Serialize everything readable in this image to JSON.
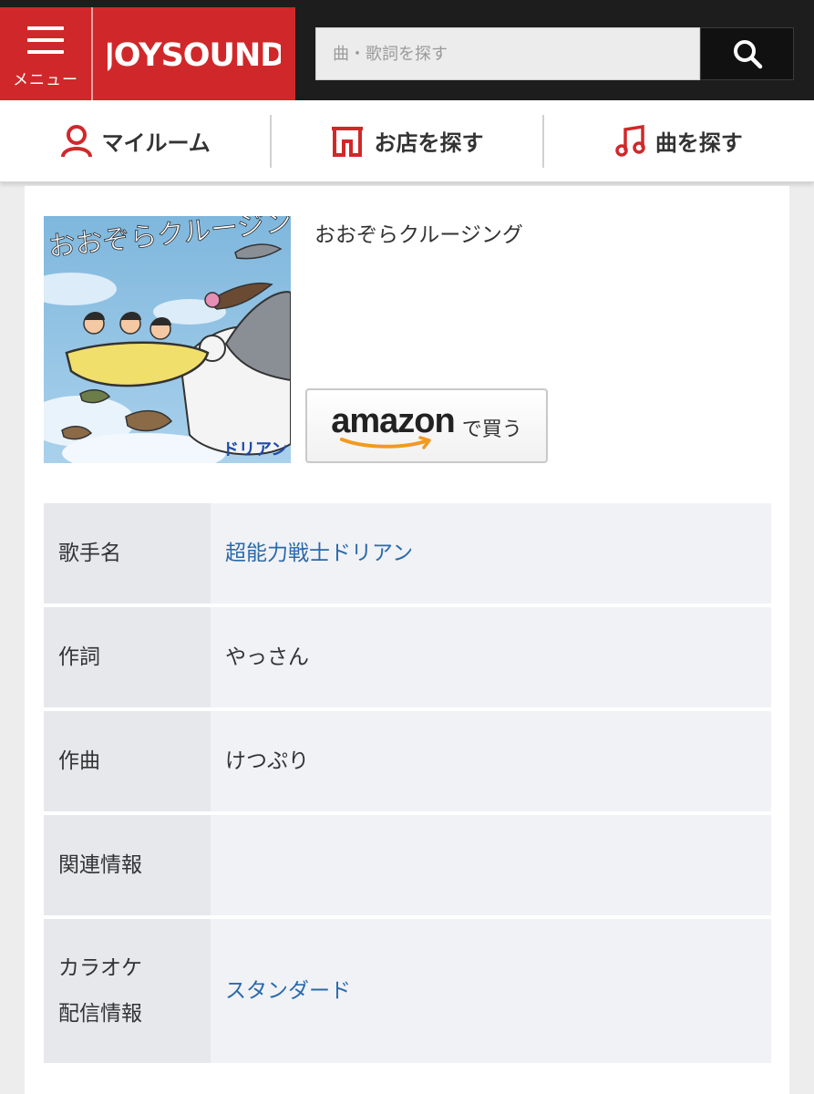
{
  "header": {
    "menu_label": "メニュー",
    "logo_text": "JOYSOUND",
    "search_placeholder": "曲・歌詞を探す",
    "brand_color": "#d0282a"
  },
  "subnav": {
    "items": [
      {
        "label": "マイルーム",
        "icon": "person-icon"
      },
      {
        "label": "お店を探す",
        "icon": "store-icon"
      },
      {
        "label": "曲を探す",
        "icon": "music-note-icon"
      }
    ]
  },
  "song": {
    "title": "おおぞらクルージング",
    "jacket_title_art": "おおぞらクルージング",
    "jacket_artist_art": "ドリアン",
    "amazon_word": "amazon",
    "amazon_suffix": "で買う"
  },
  "info": {
    "rows": [
      {
        "key": "歌手名",
        "value": "超能力戦士ドリアン",
        "link": true
      },
      {
        "key": "作詞",
        "value": "やっさん",
        "link": false
      },
      {
        "key": "作曲",
        "value": "けつぷり",
        "link": false
      },
      {
        "key": "関連情報",
        "value": "",
        "link": false
      },
      {
        "key_line1": "カラオケ",
        "key_line2": "配信情報",
        "value": "スタンダード",
        "link": true
      }
    ]
  }
}
